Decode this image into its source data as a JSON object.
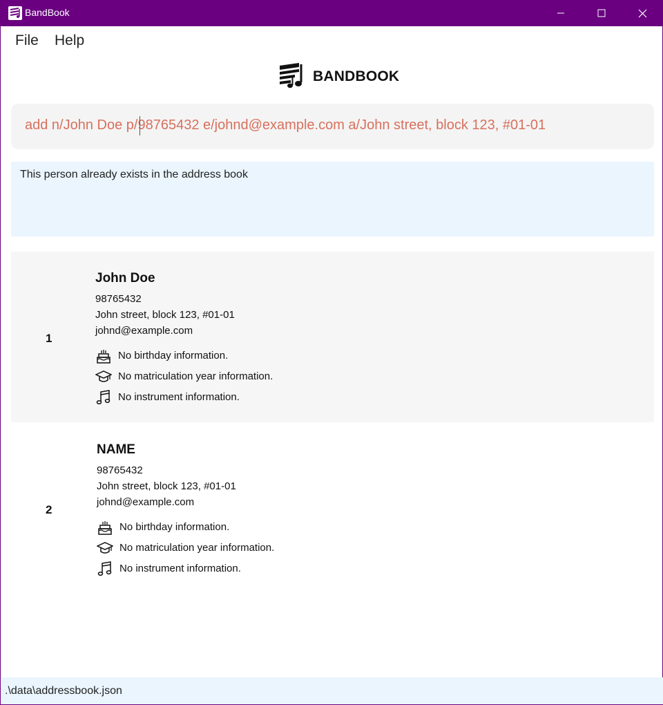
{
  "window": {
    "title": "BandBook",
    "app_icon": "bandbook-logo-icon",
    "controls": [
      "minimize-icon",
      "maximize-icon",
      "close-icon"
    ]
  },
  "menu": {
    "file": "File",
    "help": "Help"
  },
  "logo": {
    "text": "BANDBOOK",
    "icon": "music-notes-logo-icon"
  },
  "command": {
    "value": "add n/John Doe p/98765432 e/johnd@example.com a/John street, block 123, #01-01",
    "text_color": "#d8705d"
  },
  "result": {
    "message": "This person already exists in the address book"
  },
  "persons": [
    {
      "index": "1",
      "name": "John Doe",
      "phone": "98765432",
      "address": "John street, block 123, #01-01",
      "email": "johnd@example.com",
      "birthday": "No birthday information.",
      "matriculation": "No matriculation year information.",
      "instrument": "No instrument information."
    },
    {
      "index": "2",
      "name": "NAME",
      "phone": "98765432",
      "address": "John street, block 123, #01-01",
      "email": "johnd@example.com",
      "birthday": "No birthday information.",
      "matriculation": "No matriculation year information.",
      "instrument": "No instrument information."
    }
  ],
  "status": {
    "file_path": ".\\data\\addressbook.json"
  },
  "colors": {
    "title_bar": "#6a0080",
    "result_bg": "#eaf5fe",
    "card_shaded_bg": "#f6f6f6",
    "command_bg": "#f4f4f4"
  }
}
